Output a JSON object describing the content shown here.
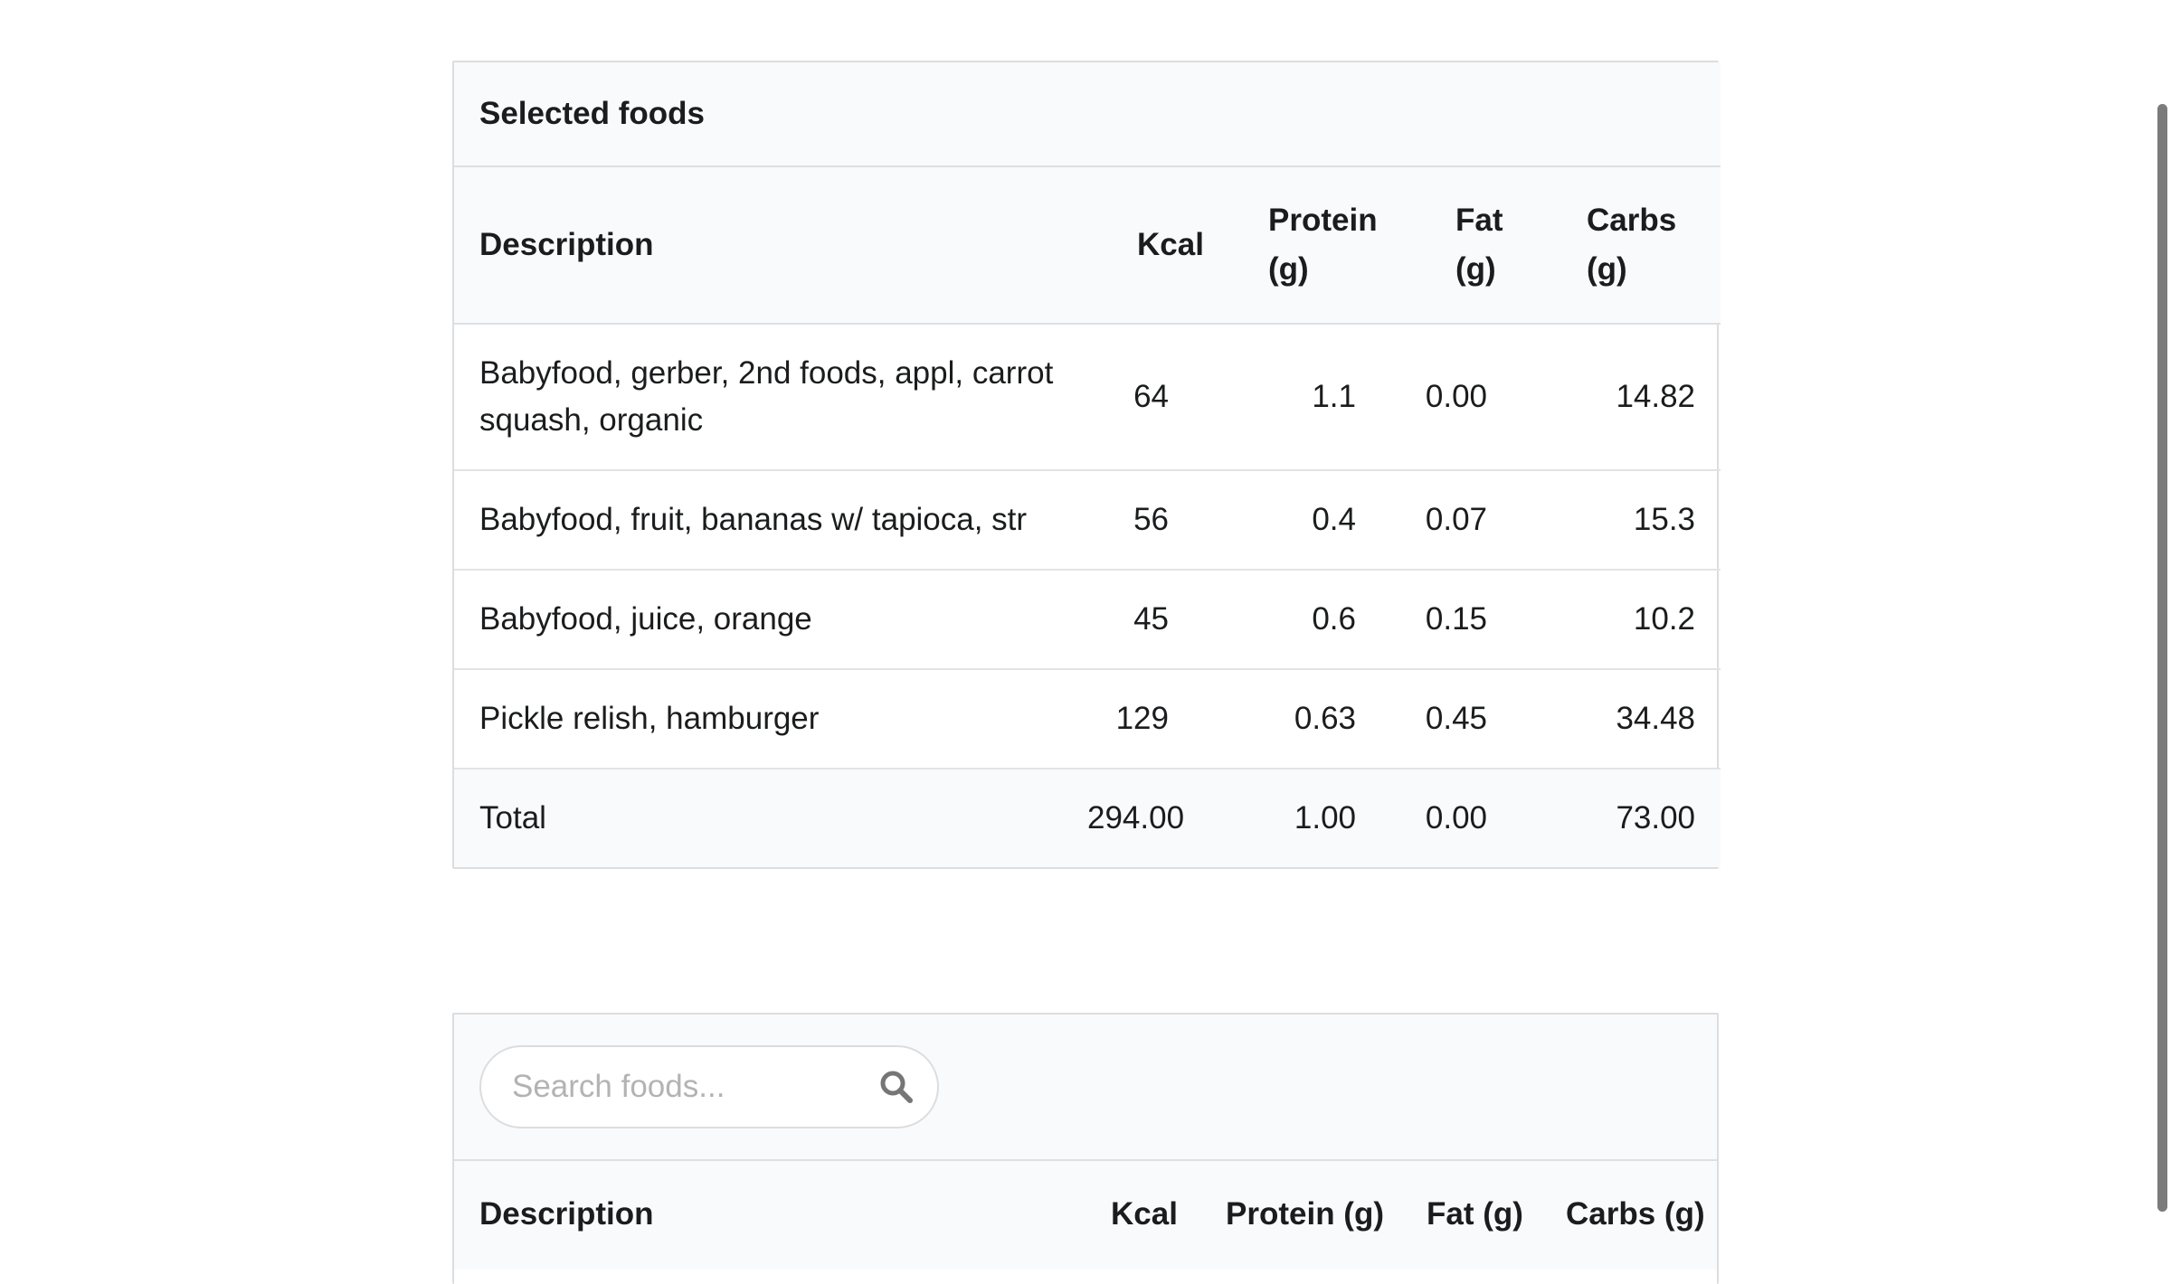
{
  "selected_panel": {
    "title": "Selected foods",
    "columns": {
      "description": "Description",
      "kcal": "Kcal",
      "protein_line1": "Protein",
      "protein_line2": "(g)",
      "fat_line1": "Fat",
      "fat_line2": "(g)",
      "carbs_line1": "Carbs",
      "carbs_line2": "(g)"
    },
    "rows": [
      {
        "description_line1": "Babyfood, gerber, 2nd foods, appl, carrot",
        "description_line2": "squash, organic",
        "kcal": "64",
        "protein": "1.1",
        "fat": "0.00",
        "carbs": "14.82"
      },
      {
        "description": "Babyfood, fruit, bananas w/ tapioca, str",
        "kcal": "56",
        "protein": "0.4",
        "fat": "0.07",
        "carbs": "15.3"
      },
      {
        "description": "Babyfood, juice, orange",
        "kcal": "45",
        "protein": "0.6",
        "fat": "0.15",
        "carbs": "10.2"
      },
      {
        "description": "Pickle relish, hamburger",
        "kcal": "129",
        "protein": "0.63",
        "fat": "0.45",
        "carbs": "34.48"
      }
    ],
    "total": {
      "label": "Total",
      "kcal": "294.00",
      "protein": "1.00",
      "fat": "0.00",
      "carbs": "73.00"
    }
  },
  "search_panel": {
    "search": {
      "placeholder": "Search foods...",
      "value": ""
    },
    "search_icon": "search-icon",
    "columns": {
      "description": "Description",
      "kcal": "Kcal",
      "protein": "Protein (g)",
      "fat": "Fat (g)",
      "carbs": "Carbs (g)"
    }
  },
  "colors": {
    "header_background": "#f9fafb",
    "border": "#dcdddf",
    "text": "#1b1c1d",
    "placeholder": "#b3b3b3",
    "scrollbar_thumb": "#7b7b7b"
  }
}
